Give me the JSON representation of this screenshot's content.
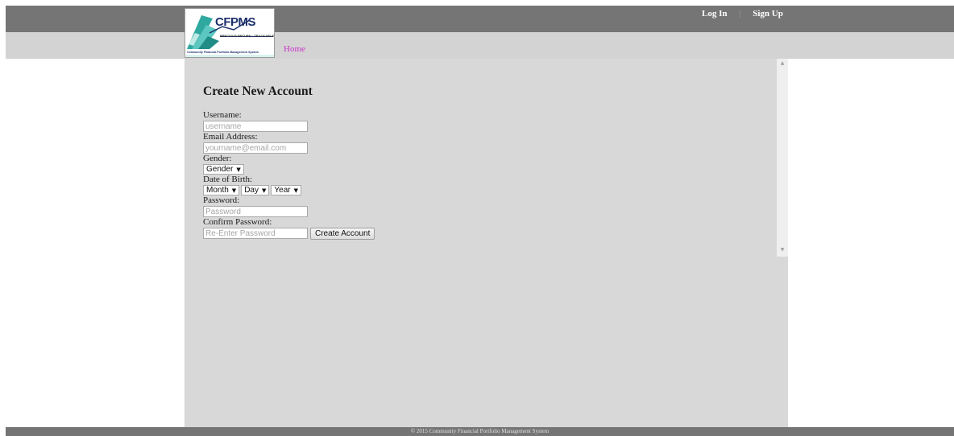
{
  "header": {
    "logo": {
      "title": "CFPMS",
      "tagline": "PRECIOUS RETURN · TRACKABLE",
      "subtitle": "Community Financial Portfolio Management System"
    },
    "nav": {
      "login": "Log In",
      "separator": "|",
      "signup": "Sign Up"
    },
    "home_link": "Home"
  },
  "form": {
    "title": "Create New Account",
    "username_label": "Username:",
    "username_placeholder": "username",
    "email_label": "Email Address:",
    "email_placeholder": "yourname@email.com",
    "gender_label": "Gender:",
    "gender_value": "Gender",
    "dob_label": "Date of Birth:",
    "month_value": "Month",
    "day_value": "Day",
    "year_value": "Year",
    "password_label": "Password:",
    "password_placeholder": "Password",
    "confirm_label": "Confirm Password:",
    "confirm_placeholder": "Re-Enter Password",
    "submit_label": "Create Account"
  },
  "footer": {
    "text": "© 2015 Community Financial Portfolio Management System"
  },
  "colors": {
    "topbar": "#757575",
    "navbar": "#d3d3d3",
    "content_bg": "#d8d8d8",
    "home_link": "#cc33cc",
    "logo_navy": "#1b2f6b"
  }
}
